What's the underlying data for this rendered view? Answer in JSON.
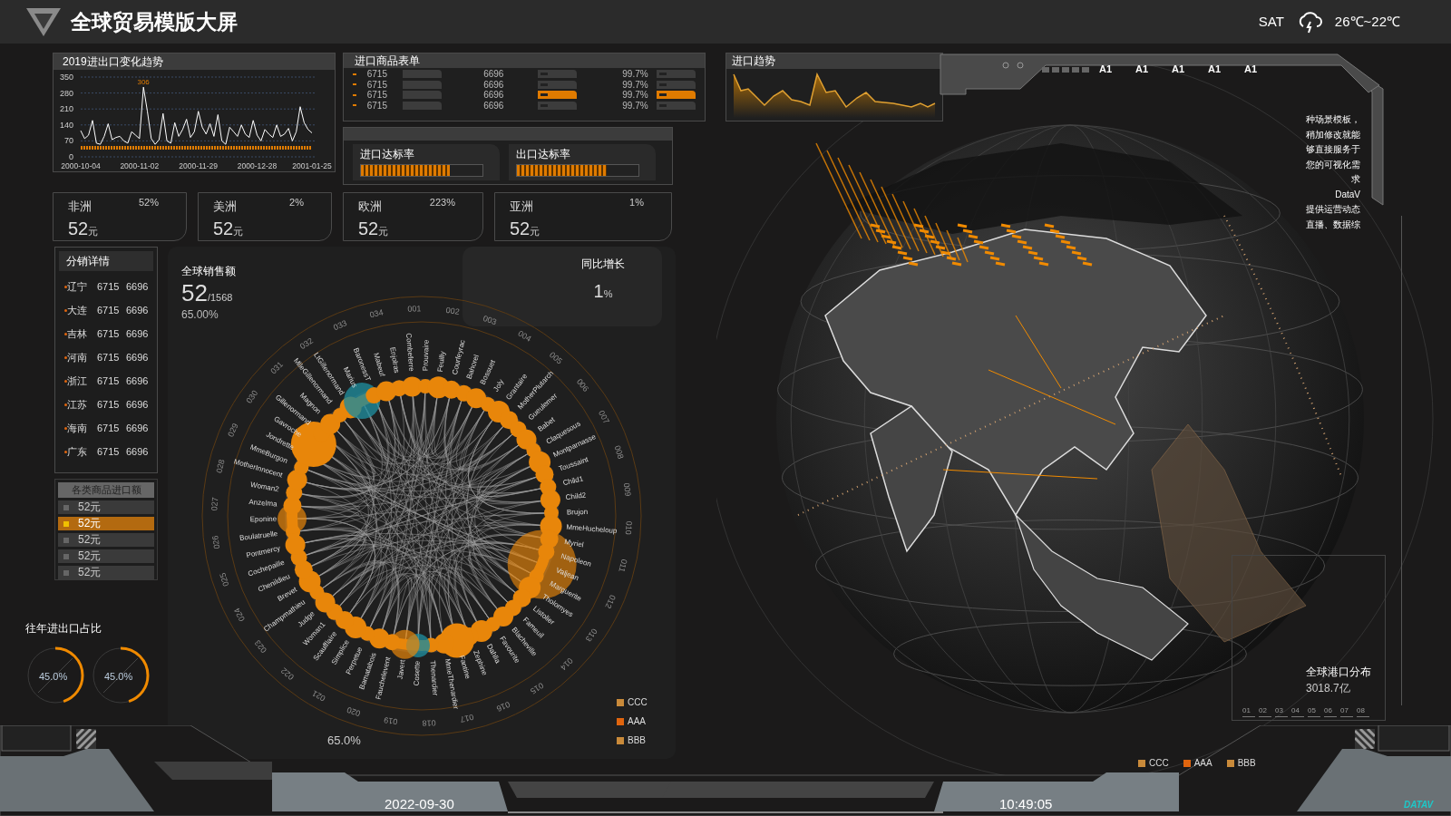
{
  "header": {
    "title": "全球贸易模版大屏",
    "weekday": "SAT",
    "temperature": "26℃~22℃"
  },
  "trend_panel": {
    "title": "2019进出口变化趋势",
    "chart_data": {
      "type": "line",
      "grid": true,
      "ylim": [
        0,
        350
      ],
      "yticks": [
        0,
        70,
        140,
        210,
        280,
        350
      ],
      "categories": [
        "2000-10-04",
        null,
        null,
        null,
        null,
        null,
        null,
        null,
        null,
        null,
        null,
        null,
        null,
        null,
        null,
        "2000-11-02",
        null,
        null,
        null,
        null,
        null,
        null,
        null,
        null,
        null,
        null,
        null,
        null,
        null,
        null,
        "2000-11-29",
        null,
        null,
        null,
        null,
        null,
        null,
        null,
        null,
        null,
        null,
        null,
        null,
        null,
        null,
        "2000-12-28",
        null,
        null,
        null,
        null,
        null,
        null,
        null,
        null,
        null,
        null,
        null,
        null,
        null,
        "2001-01-25"
      ],
      "series": [
        {
          "color": "#ffffff",
          "values": [
            115,
            80,
            95,
            160,
            60,
            55,
            90,
            145,
            75,
            85,
            90,
            70,
            60,
            110,
            95,
            80,
            306,
            200,
            80,
            55,
            75,
            190,
            70,
            60,
            150,
            90,
            120,
            165,
            85,
            110,
            200,
            130,
            100,
            145,
            90,
            185,
            70,
            55,
            130,
            110,
            90,
            140,
            100,
            85,
            160,
            95,
            70,
            120,
            100,
            85,
            140,
            90,
            100,
            125,
            70,
            110,
            220,
            150,
            120,
            105
          ]
        },
        {
          "color": "#e07b00",
          "line_style": "dashed",
          "values": [
            40,
            40,
            40,
            40,
            40,
            40,
            40,
            40,
            40,
            40,
            40,
            40,
            40,
            40,
            40,
            40,
            40,
            40,
            40,
            40,
            40,
            40,
            40,
            40,
            40,
            40,
            40,
            40,
            40,
            40,
            40,
            40,
            40,
            40,
            40,
            40,
            40,
            40,
            40,
            40,
            40,
            40,
            40,
            40,
            40,
            40,
            40,
            40,
            40,
            40,
            40,
            40,
            40,
            40,
            40,
            40,
            40,
            40,
            40,
            40
          ]
        }
      ],
      "annotations": [
        {
          "y": 306,
          "text": "306"
        }
      ]
    }
  },
  "goods_panel": {
    "title": "进口商品表单",
    "rows": [
      {
        "col_1": "6715",
        "col_2": "6696",
        "col_3": "99.7%",
        "highlighted": false
      },
      {
        "col_1": "6715",
        "col_2": "6696",
        "col_3": "99.7%",
        "highlighted": false
      },
      {
        "col_1": "6715",
        "col_2": "6696",
        "col_3": "99.7%",
        "highlighted": true
      },
      {
        "col_1": "6715",
        "col_2": "6696",
        "col_3": "99.7%",
        "highlighted": false
      }
    ]
  },
  "target_panel": {
    "meters": [
      {
        "label": "进口达标率",
        "level": 0.73
      },
      {
        "label": "出口达标率",
        "level": 0.74
      }
    ]
  },
  "import_trend": {
    "title": "进口趋势"
  },
  "regions": [
    {
      "name": "非洲",
      "percent": "52%",
      "value": "52",
      "unit": "元"
    },
    {
      "name": "美洲",
      "percent": "2%",
      "value": "52",
      "unit": "元"
    },
    {
      "name": "欧洲",
      "percent": "223%",
      "value": "52",
      "unit": "元"
    },
    {
      "name": "亚洲",
      "percent": "1%",
      "value": "52",
      "unit": "元"
    }
  ],
  "distribution": {
    "title": "分销详情",
    "rows": [
      {
        "name": "辽宁",
        "col_1": "6715",
        "col_2": "6696"
      },
      {
        "name": "大连",
        "col_1": "6715",
        "col_2": "6696"
      },
      {
        "name": "吉林",
        "col_1": "6715",
        "col_2": "6696"
      },
      {
        "name": "河南",
        "col_1": "6715",
        "col_2": "6696"
      },
      {
        "name": "浙江",
        "col_1": "6715",
        "col_2": "6696"
      },
      {
        "name": "江苏",
        "col_1": "6715",
        "col_2": "6696"
      },
      {
        "name": "海南",
        "col_1": "6715",
        "col_2": "6696"
      },
      {
        "name": "广东",
        "col_1": "6715",
        "col_2": "6696"
      }
    ]
  },
  "category_imports": {
    "title": "各类商品进口额",
    "items": [
      {
        "label": "52元",
        "selected": false
      },
      {
        "label": "52元",
        "selected": true
      },
      {
        "label": "52元",
        "selected": false
      },
      {
        "label": "52元",
        "selected": false
      },
      {
        "label": "52元",
        "selected": false
      }
    ]
  },
  "yearly_ratio": {
    "title": "往年进出口占比",
    "rings": [
      {
        "label": "45.0%",
        "level": 0.45
      },
      {
        "label": "45.0%",
        "level": 0.45
      }
    ]
  },
  "global_sales": {
    "title": "全球销售额",
    "value": "52",
    "total": "/1568",
    "percent": "65.00%"
  },
  "yoy_growth": {
    "title": "同比增长",
    "value": "1",
    "unit": "%"
  },
  "chord_diagram": {
    "node_labels": [
      "Enjolras",
      "Combeferre",
      "Prouvaire",
      "Feuilly",
      "Courfeyrac",
      "Bahorel",
      "Bossuet",
      "Joly",
      "Grantaire",
      "MotherPlutarch",
      "Gueulemer",
      "Babet",
      "Claquesous",
      "Montparnasse",
      "Toussaint",
      "Child1",
      "Child2",
      "Brujon",
      "MmeHucheloup",
      "Myriel",
      "Napoleon",
      "Valjean",
      "Marguerite",
      "Tholomyes",
      "Listolier",
      "Fameuil",
      "Blacheville",
      "Favourite",
      "Dahlia",
      "Zephine",
      "Fantine",
      "MmeThenardier",
      "Thenardier",
      "Cosette",
      "Javert",
      "Fauchelevent",
      "Bamatabois",
      "Perpetue",
      "Simplice",
      "Scaufflaire",
      "Woman1",
      "Judge",
      "Champmathieu",
      "Brevet",
      "Chenildieu",
      "Cochepaille",
      "Pontmercy",
      "Boulatruelle",
      "Eponine",
      "Anzelma",
      "Woman2",
      "MotherInnocent",
      "MmeBurgon",
      "Jondrette",
      "Gavroche",
      "Gillenormand",
      "Magnon",
      "MlleGillenormand",
      "LtGillenormand",
      "Marius",
      "BaronessT",
      "Mabeuf"
    ],
    "ring_labels": [
      "001",
      "002",
      "003",
      "004",
      "005",
      "006",
      "007",
      "008",
      "009",
      "010",
      "011",
      "012",
      "013",
      "014",
      "015",
      "016",
      "017",
      "018",
      "019",
      "020",
      "021",
      "022",
      "023",
      "024",
      "025",
      "026",
      "027",
      "028",
      "029",
      "030",
      "031",
      "032",
      "033",
      "034"
    ],
    "footer": "65.0%",
    "legend": [
      {
        "label": "CCC",
        "color": "#c98a3a"
      },
      {
        "label": "AAA",
        "color": "#e0650e"
      },
      {
        "label": "BBB",
        "color": "#c98a3a"
      }
    ]
  },
  "tabs": [
    {
      "label": "A1"
    },
    {
      "label": "A1"
    },
    {
      "label": "A1"
    },
    {
      "label": "A1"
    },
    {
      "label": "A1"
    }
  ],
  "intro_lines": [
    "种场景模板，",
    "稍加修改就能",
    "够直接服务于",
    "您的可视化需",
    "求",
    "DataV",
    "提供运营动态",
    "直播、数据综"
  ],
  "port_panel": {
    "title": "全球港口分布",
    "value": "3018.7亿",
    "ruler_labels": [
      "01",
      "02",
      "03",
      "04",
      "05",
      "06",
      "07",
      "08"
    ]
  },
  "map_legend": [
    {
      "label": "CCC",
      "color": "#c98a3a"
    },
    {
      "label": "AAA",
      "color": "#e0650e"
    },
    {
      "label": "BBB",
      "color": "#c98a3a"
    }
  ],
  "footer": {
    "date": "2022-09-30",
    "time": "10:49:05",
    "logo": "DATAV"
  }
}
